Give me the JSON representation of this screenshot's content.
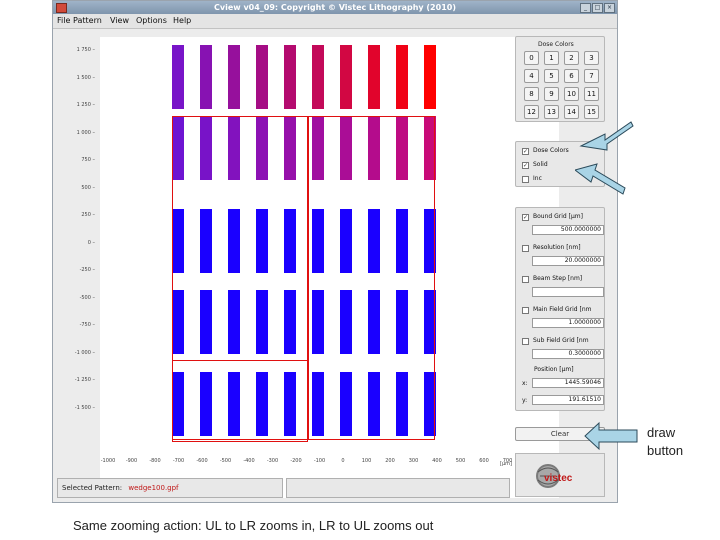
{
  "window": {
    "title": "Cview v04_09: Copyright © Vistec Lithography (2010)",
    "buttons": [
      "_",
      "□",
      "×"
    ]
  },
  "menu": [
    "File",
    "Pattern",
    "View",
    "Options",
    "Help"
  ],
  "plot": {
    "y_ticks": [
      "1 750",
      "1 500",
      "1 250",
      "1 000",
      "750",
      "500",
      "250",
      "0",
      "-250",
      "-500",
      "-750",
      "-1 000",
      "-1 250",
      "-1 500"
    ],
    "x_ticks": [
      "-1000",
      "-900",
      "-800",
      "-700",
      "-600",
      "-500",
      "-400",
      "-300",
      "-200",
      "-100",
      "0",
      "100",
      "200",
      "300",
      "400",
      "500",
      "600",
      "700"
    ],
    "x_unit": "[µm]"
  },
  "dose_colors": {
    "title": "Dose Colors",
    "buttons": [
      "0",
      "1",
      "2",
      "3",
      "4",
      "5",
      "6",
      "7",
      "8",
      "9",
      "10",
      "11",
      "12",
      "13",
      "14",
      "15"
    ]
  },
  "display_options": [
    {
      "label": "Dose Colors",
      "checked": true
    },
    {
      "label": "Solid",
      "checked": true
    },
    {
      "label": "Inc",
      "checked": false
    }
  ],
  "grid_panel": {
    "bound_grid": {
      "label": "Bound Grid [µm]",
      "checked": true,
      "value": "500.0000000"
    },
    "resolution": {
      "label": "Resolution [nm]",
      "checked": false,
      "value": "20.0000000"
    },
    "beam_step": {
      "label": "Beam Step [nm]",
      "checked": false,
      "value": ""
    },
    "main_field": {
      "label": "Main Field Grid [nm",
      "checked": false,
      "value": "1.0000000"
    },
    "sub_field": {
      "label": "Sub Field Grid [nm",
      "checked": false,
      "value": "0.3000000"
    },
    "position_label": "Position [µm]",
    "x_label": "x:",
    "x_value": "1445.59046",
    "y_label": "y:",
    "y_value": "191.61510"
  },
  "clear_button": "Clear",
  "status": {
    "selected_label": "Selected Pattern:",
    "selected_value": "wedge100.gpf"
  },
  "logo_text": "vistec",
  "annotations": {
    "draw_button": "draw\nbutton",
    "caption": "Same zooming action:  UL to LR zooms in,  LR to UL zooms out"
  },
  "colors": {
    "arrow_fill": "#a9d4e6",
    "bar_top_right": "#ff0000",
    "bar_blue": "#1a00ff",
    "bar_purple": "#7a10c8"
  }
}
